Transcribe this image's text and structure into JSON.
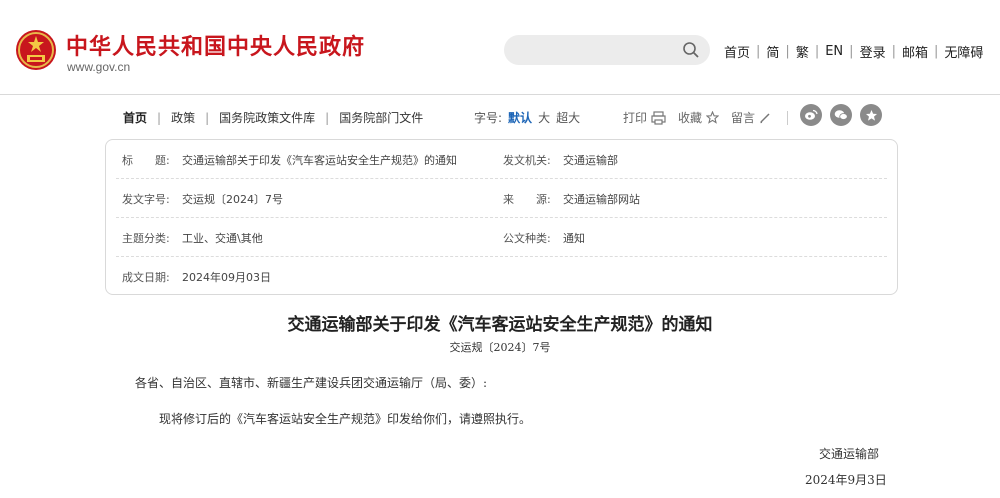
{
  "header": {
    "site_name": "中华人民共和国中央人民政府",
    "site_url": "www.gov.cn",
    "nav_links": [
      "首页",
      "简",
      "繁",
      "EN",
      "登录",
      "邮箱",
      "无障碍"
    ]
  },
  "breadcrumb": [
    "首页",
    "政策",
    "国务院政策文件库",
    "国务院部门文件"
  ],
  "toolbar": {
    "fontsize_label": "字号:",
    "fontsize_options": [
      "默认",
      "大",
      "超大"
    ],
    "print_label": "打印",
    "favorite_label": "收藏",
    "comment_label": "留言"
  },
  "info": {
    "title_label": "标　　题:",
    "title_value": "交通运输部关于印发《汽车客运站安全生产规范》的通知",
    "issuer_label": "发文机关:",
    "issuer_value": "交通运输部",
    "docno_label": "发文字号:",
    "docno_value": "交运规〔2024〕7号",
    "source_label": "来　　源:",
    "source_value": "交通运输部网站",
    "topic_label": "主题分类:",
    "topic_value": "工业、交通\\其他",
    "type_label": "公文种类:",
    "type_value": "通知",
    "date_label": "成文日期:",
    "date_value": "2024年09月03日"
  },
  "document": {
    "title": "交通运输部关于印发《汽车客运站安全生产规范》的通知",
    "number": "交运规〔2024〕7号",
    "addressee": "各省、自治区、直辖市、新疆生产建设兵团交通运输厅（局、委）:",
    "body": "现将修订后的《汽车客运站安全生产规范》印发给你们，请遵照执行。",
    "signature": "交通运输部",
    "date": "2024年9月3日"
  },
  "colors": {
    "brand_red": "#c8161d",
    "active_blue": "#1e66b7"
  }
}
